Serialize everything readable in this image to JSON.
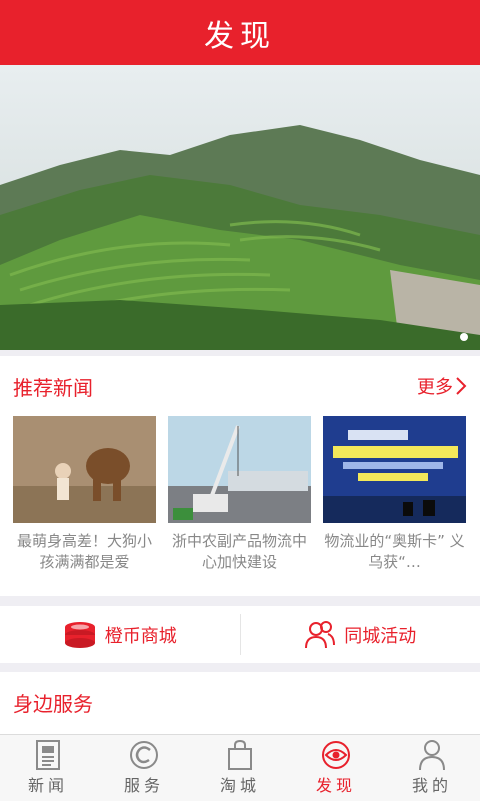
{
  "header": {
    "title": "发现"
  },
  "banner": {
    "alt_icon": "landscape-photo",
    "active_dot": 1
  },
  "recommended": {
    "title": "推荐新闻",
    "more_label": "更多",
    "items": [
      {
        "caption": "最萌身高差！大狗小孩满满都是爱"
      },
      {
        "caption": "浙中农副产品物流中心加快建设"
      },
      {
        "caption": "物流业的“奥斯卡” 义乌获“…"
      }
    ]
  },
  "shortcuts": [
    {
      "label": "橙币商城",
      "icon": "coins-icon"
    },
    {
      "label": "同城活动",
      "icon": "people-icon"
    }
  ],
  "services": {
    "title": "身边服务"
  },
  "tabs": [
    {
      "label": "新闻",
      "icon": "newspaper-icon",
      "active": false
    },
    {
      "label": "服务",
      "icon": "service-icon",
      "active": false
    },
    {
      "label": "淘城",
      "icon": "bag-icon",
      "active": false
    },
    {
      "label": "发现",
      "icon": "eye-icon",
      "active": true
    },
    {
      "label": "我的",
      "icon": "user-icon",
      "active": false
    }
  ],
  "colors": {
    "brand": "#e8212c",
    "background": "#efeef3",
    "tab_inactive": "#666666"
  }
}
